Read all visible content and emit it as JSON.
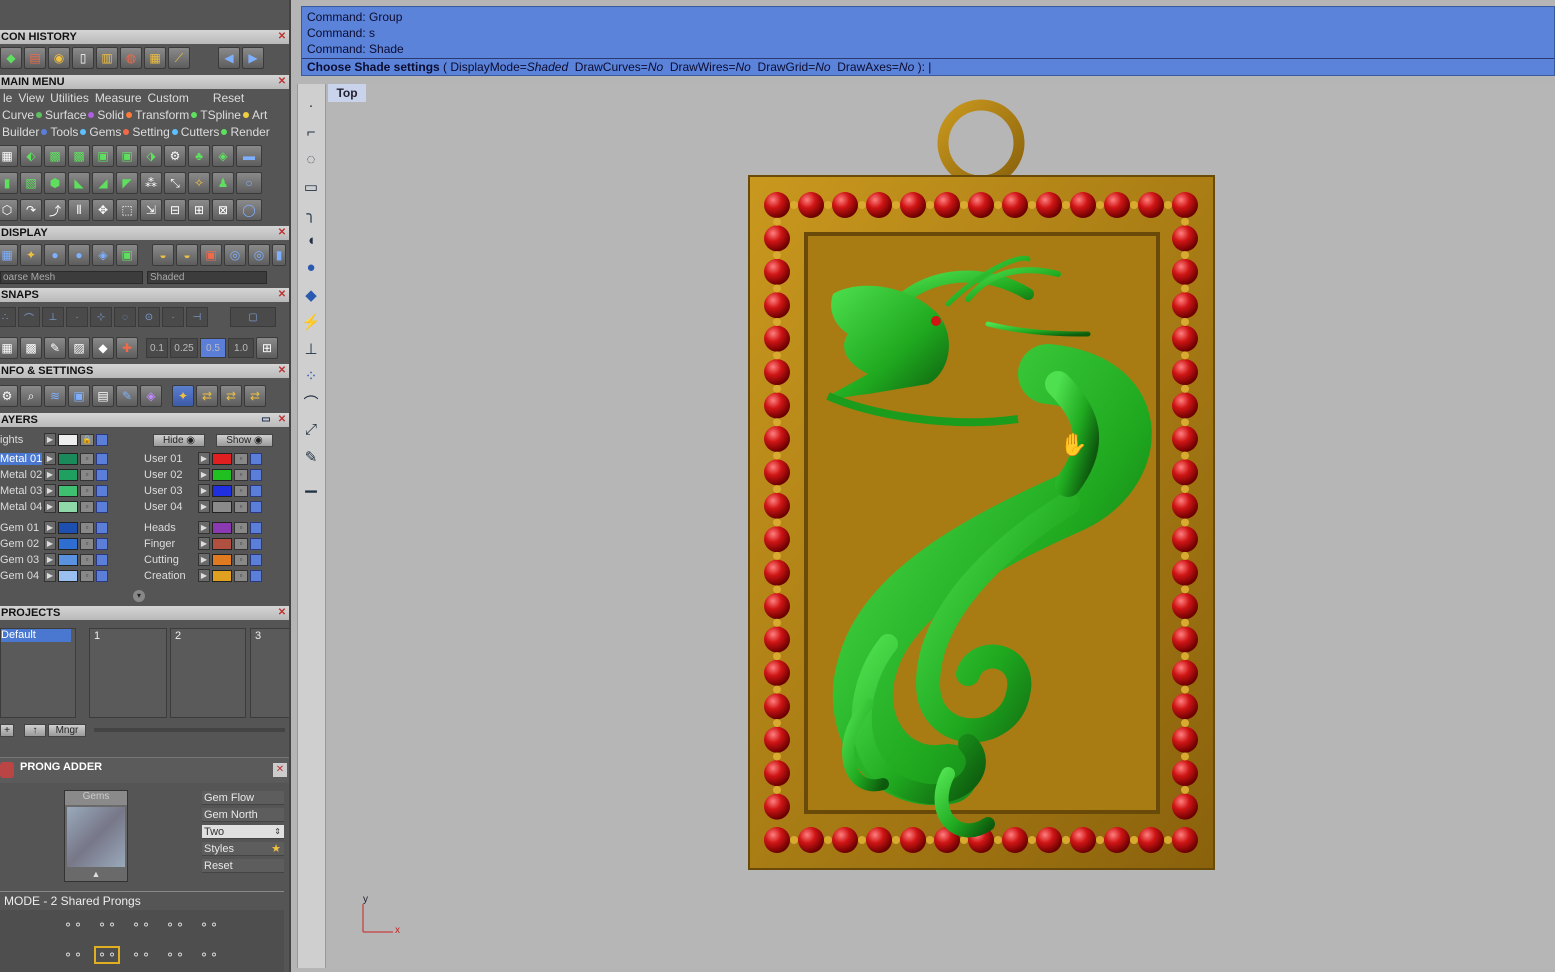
{
  "panels": {
    "icon_history": "CON HISTORY",
    "main_menu": "MAIN MENU",
    "display": "DISPLAY",
    "snaps": "SNAPS",
    "info_settings": "NFO & SETTINGS",
    "layers": "AYERS",
    "projects": "PROJECTS",
    "prong_adder": "PRONG ADDER"
  },
  "menu": {
    "row1": [
      "le",
      "View",
      "Utilities",
      "Measure",
      "Custom",
      "Reset"
    ],
    "row2": [
      {
        "label": "Curve",
        "color": "#5ec0ff"
      },
      {
        "label": "Surface",
        "color": "#5ec05e"
      },
      {
        "label": "Solid",
        "color": "#b05ee0"
      },
      {
        "label": "Transform",
        "color": "#ff7a3a"
      },
      {
        "label": "TSpline",
        "color": "#5ee05e"
      },
      {
        "label": "Art",
        "color": "#f0d040"
      }
    ],
    "row3": [
      {
        "label": "Builder",
        "color": ""
      },
      {
        "label": "Tools",
        "color": "#5b7fd8"
      },
      {
        "label": "Gems",
        "color": "#5ec0ff"
      },
      {
        "label": "Setting",
        "color": "#f06a4a"
      },
      {
        "label": "Cutters",
        "color": "#5ec0ff"
      },
      {
        "label": "Render",
        "color": "#5ee05e"
      }
    ]
  },
  "display": {
    "mesh_select": "oarse Mesh",
    "mode_select": "Shaded"
  },
  "snaps": {
    "values": [
      "0.1",
      "0.25",
      "0.5",
      "1.0"
    ]
  },
  "layers": {
    "lights": "ights",
    "hide": "Hide",
    "show": "Show",
    "left": [
      {
        "name": "Metal 01",
        "color": "#1a8a5a",
        "active": true
      },
      {
        "name": "Metal 02",
        "color": "#1fa060"
      },
      {
        "name": "Metal 03",
        "color": "#3ec070"
      },
      {
        "name": "Metal 04",
        "color": "#8fd8a8"
      }
    ],
    "left2": [
      {
        "name": "Gem 01",
        "color": "#1c4fb0"
      },
      {
        "name": "Gem 02",
        "color": "#2e6ed0"
      },
      {
        "name": "Gem 03",
        "color": "#5a92e0"
      },
      {
        "name": "Gem 04",
        "color": "#9ac0f0"
      }
    ],
    "right": [
      {
        "name": "User 01",
        "color": "#e02020"
      },
      {
        "name": "User 02",
        "color": "#20c020"
      },
      {
        "name": "User 03",
        "color": "#2030e0"
      },
      {
        "name": "User 04",
        "color": "#8a8a8a"
      }
    ],
    "right2": [
      {
        "name": "Heads",
        "color": "#8a3ab0"
      },
      {
        "name": "Finger",
        "color": "#b05040"
      },
      {
        "name": "Cutting",
        "color": "#e07a20"
      },
      {
        "name": "Creation",
        "color": "#e0a020"
      }
    ]
  },
  "projects": {
    "default": "Default",
    "slots": [
      "1",
      "2",
      "3"
    ],
    "mngr": "Mngr"
  },
  "prong": {
    "gems_label": "Gems",
    "props": [
      "Gem Flow",
      "Gem North",
      "Two",
      "Styles",
      "Reset"
    ],
    "mode": "MODE - 2 Shared Prongs"
  },
  "command": {
    "lines": [
      "Command: Group",
      "Command: s",
      "Command: Shade"
    ],
    "prompt": "Choose Shade settings",
    "open": " ( ",
    "opts": [
      {
        "k": "DisplayMode=",
        "v": "Shaded"
      },
      {
        "k": "DrawCurves=",
        "v": "No"
      },
      {
        "k": "DrawWires=",
        "v": "No"
      },
      {
        "k": "DrawGrid=",
        "v": "No"
      },
      {
        "k": "DrawAxes=",
        "v": "No"
      }
    ],
    "close": " ): "
  },
  "viewport": {
    "label": "Top",
    "axis_y": "y",
    "axis_x": "x"
  },
  "colors": {
    "gold": "#a87c12",
    "ruby": "#cc1212",
    "dragon": "#1fa81f"
  }
}
